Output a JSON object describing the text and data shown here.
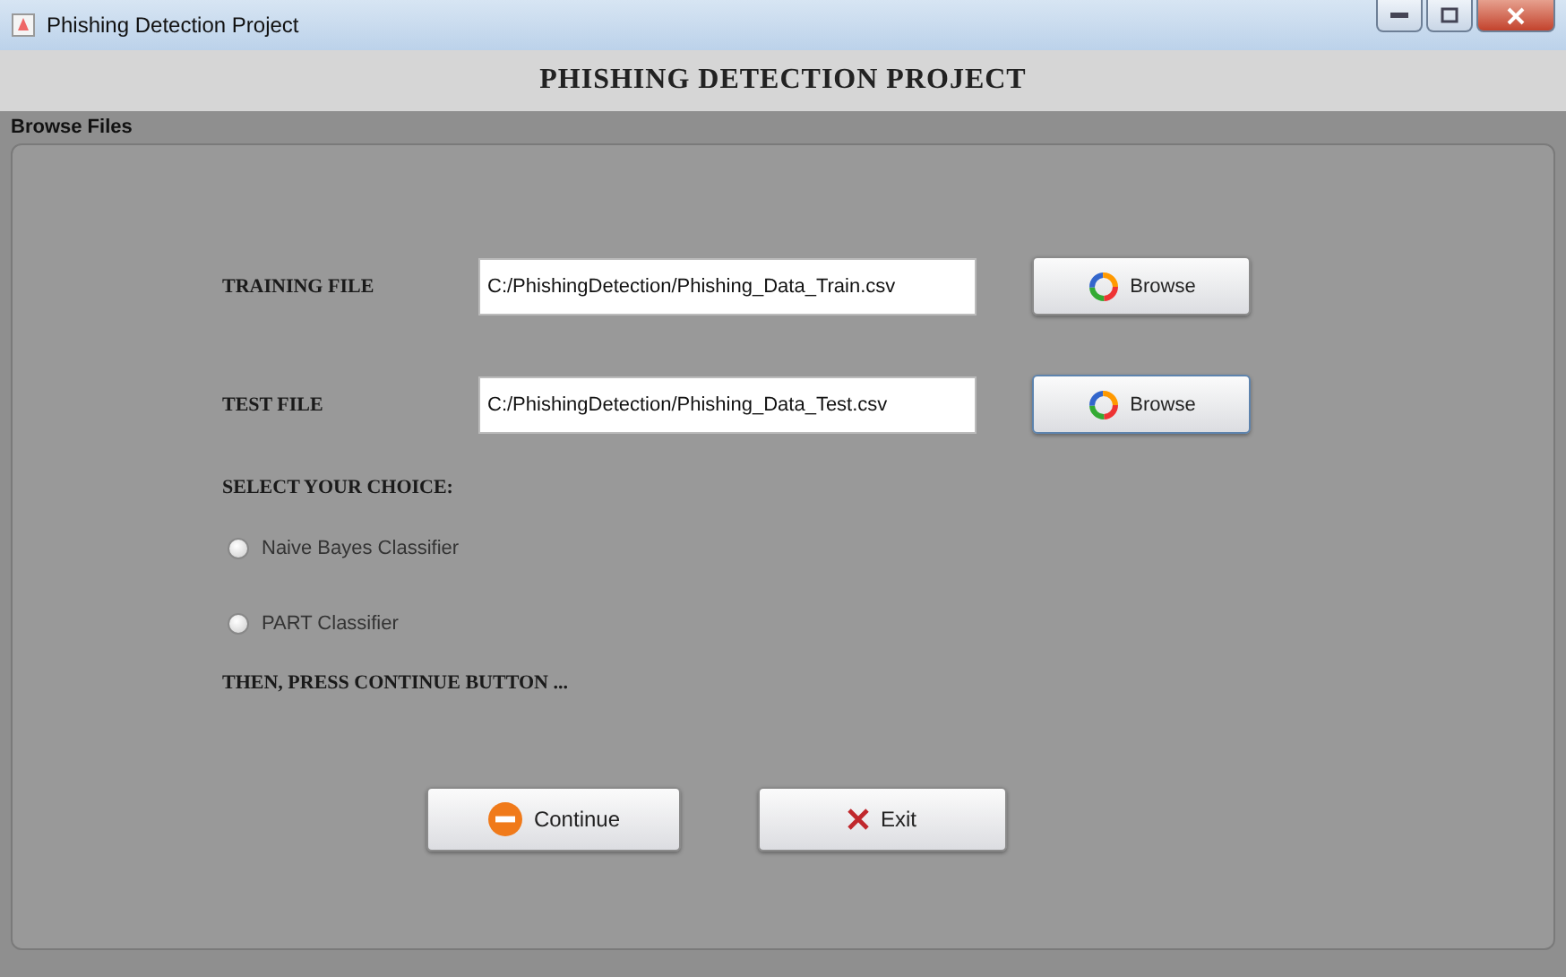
{
  "window": {
    "title": "Phishing Detection Project"
  },
  "header": "PHISHING DETECTION PROJECT",
  "section_label": "Browse Files",
  "files": [
    {
      "label": "TRAINING FILE",
      "value": "C:/PhishingDetection/Phishing_Data_Train.csv",
      "button": "Browse",
      "focused": false
    },
    {
      "label": "TEST FILE",
      "value": "C:/PhishingDetection/Phishing_Data_Test.csv",
      "button": "Browse",
      "focused": true
    }
  ],
  "choice_label": "SELECT YOUR CHOICE:",
  "options": [
    {
      "label": "Naive Bayes Classifier",
      "selected": false
    },
    {
      "label": "PART Classifier",
      "selected": false
    }
  ],
  "instruction": "THEN, PRESS CONTINUE BUTTON ...",
  "buttons": [
    {
      "kind": "continue",
      "label": "Continue"
    },
    {
      "kind": "exit",
      "label": "Exit"
    }
  ]
}
